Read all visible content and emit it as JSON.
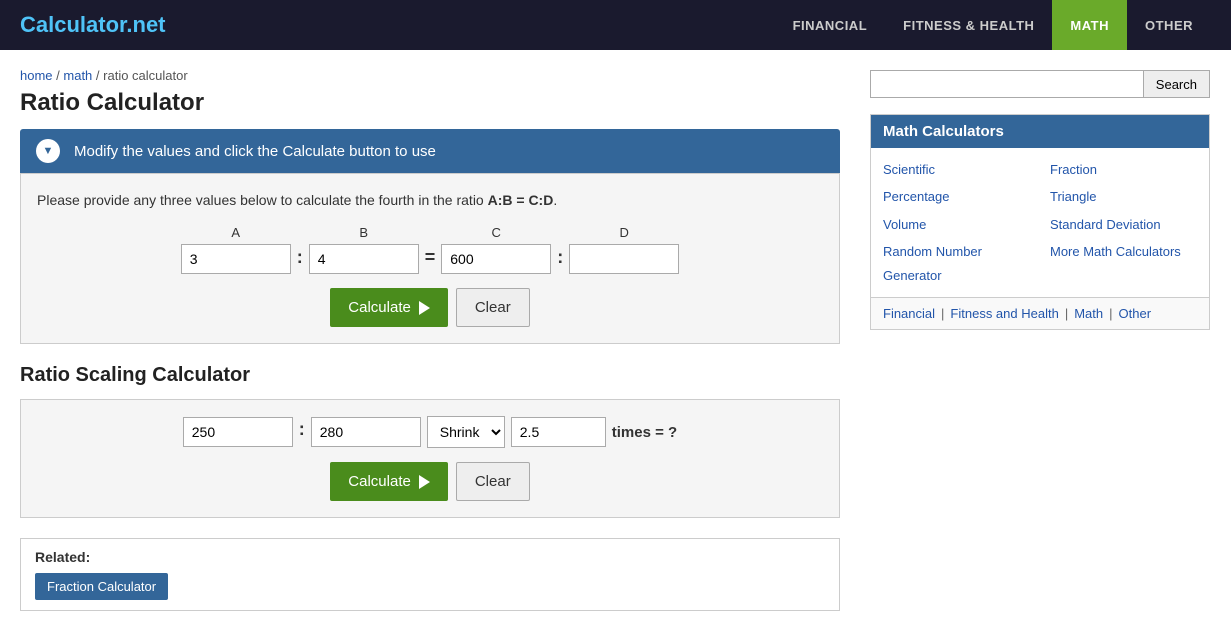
{
  "header": {
    "logo_text": "Calculator",
    "logo_dot": ".",
    "logo_net": "net",
    "nav": [
      {
        "label": "FINANCIAL",
        "active": false
      },
      {
        "label": "FITNESS & HEALTH",
        "active": false
      },
      {
        "label": "MATH",
        "active": true
      },
      {
        "label": "OTHER",
        "active": false
      }
    ]
  },
  "breadcrumb": {
    "home": "home",
    "math": "math",
    "current": "ratio calculator"
  },
  "page": {
    "title": "Ratio Calculator",
    "banner_text": "Modify the values and click the Calculate button to use",
    "description_part1": "Please provide any three values below to calculate the fourth in the ratio ",
    "description_formula": "A:B = C:D",
    "description_part2": "."
  },
  "ratio_calculator": {
    "label_a": "A",
    "label_b": "B",
    "label_c": "C",
    "label_d": "D",
    "value_a": "3",
    "value_b": "4",
    "value_c": "600",
    "value_d": "",
    "btn_calculate": "Calculate",
    "btn_clear": "Clear"
  },
  "scaling_calculator": {
    "title": "Ratio Scaling Calculator",
    "value_left": "250",
    "value_right": "280",
    "select_value": "Shrink",
    "select_options": [
      "Shrink",
      "Grow"
    ],
    "value_times": "2.5",
    "eq_text": "times = ?",
    "btn_calculate": "Calculate",
    "btn_clear": "Clear"
  },
  "related": {
    "label": "Related:",
    "links": [
      {
        "text": "Fraction Calculator"
      }
    ]
  },
  "sidebar": {
    "search": {
      "placeholder": "",
      "btn_label": "Search"
    },
    "math_panel": {
      "header": "Math Calculators",
      "links": [
        {
          "text": "Scientific",
          "col": 1
        },
        {
          "text": "Fraction",
          "col": 2
        },
        {
          "text": "Percentage",
          "col": 1
        },
        {
          "text": "Triangle",
          "col": 2
        },
        {
          "text": "Volume",
          "col": 1
        },
        {
          "text": "Standard Deviation",
          "col": 2
        },
        {
          "text": "Random Number Generator",
          "col": 1
        },
        {
          "text": "More Math Calculators",
          "col": 2
        }
      ]
    },
    "category_links": [
      {
        "text": "Financial"
      },
      {
        "text": "Fitness and Health"
      },
      {
        "text": "Math"
      },
      {
        "text": "Other"
      }
    ]
  }
}
